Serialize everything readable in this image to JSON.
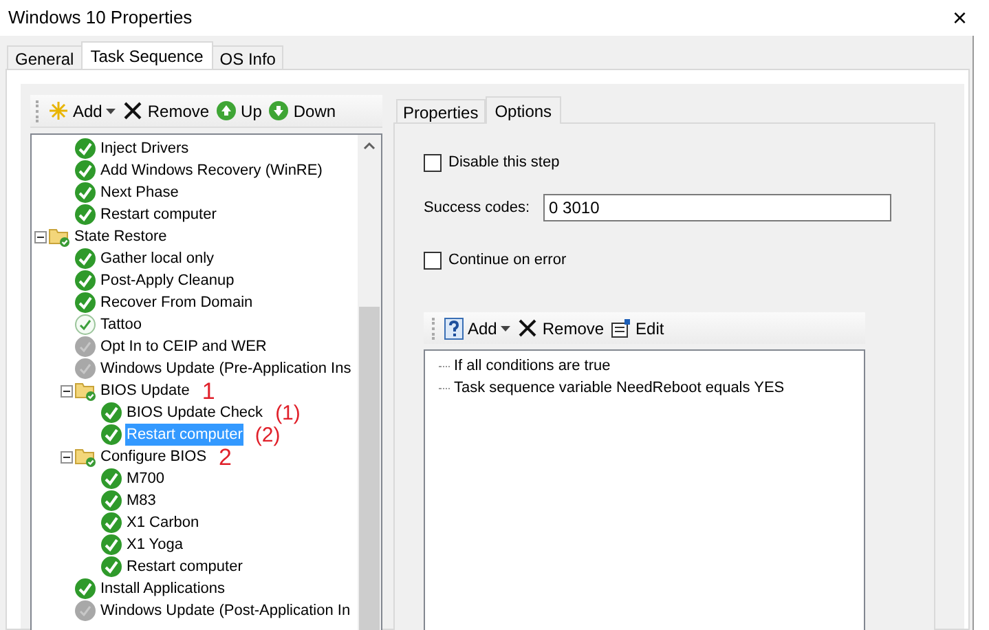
{
  "window": {
    "title": "Windows 10 Properties",
    "close": "×"
  },
  "tabs": [
    {
      "label": "General",
      "selected": false
    },
    {
      "label": "Task Sequence",
      "selected": true
    },
    {
      "label": "OS Info",
      "selected": false
    }
  ],
  "toolbar": [
    {
      "kind": "add",
      "label": "Add"
    },
    {
      "kind": "remove",
      "label": "Remove"
    },
    {
      "kind": "up",
      "label": "Up"
    },
    {
      "kind": "down",
      "label": "Down"
    }
  ],
  "tree": {
    "items": [
      {
        "kind": "offscreen-group",
        "children": [
          {
            "kind": "success",
            "label": "Inject Drivers",
            "selected": false
          },
          {
            "kind": "success",
            "label": "Add Windows Recovery (WinRE)",
            "selected": false
          },
          {
            "kind": "success",
            "label": "Next Phase",
            "selected": false
          },
          {
            "kind": "success",
            "label": "Restart computer",
            "selected": false
          }
        ]
      },
      {
        "kind": "group",
        "label": "State Restore",
        "expanded": true,
        "selected": false,
        "children": [
          {
            "kind": "success",
            "label": "Gather local only",
            "selected": false
          },
          {
            "kind": "success",
            "label": "Post-Apply Cleanup",
            "selected": false
          },
          {
            "kind": "success",
            "label": "Recover From Domain",
            "selected": false
          },
          {
            "kind": "light",
            "label": "Tattoo",
            "selected": false
          },
          {
            "kind": "disabled",
            "label": "Opt In to CEIP and WER",
            "selected": false
          },
          {
            "kind": "disabled",
            "label": "Windows Update (Pre-Application Ins",
            "selected": false
          },
          {
            "kind": "group",
            "label": "BIOS Update",
            "expanded": true,
            "selected": false,
            "annotation": "1",
            "children": [
              {
                "kind": "success",
                "label": "BIOS Update Check",
                "selected": false,
                "annotation": "(1)"
              },
              {
                "kind": "success",
                "label": "Restart computer",
                "selected": true,
                "annotation": "(2)"
              }
            ]
          },
          {
            "kind": "group",
            "label": "Configure BIOS",
            "expanded": true,
            "selected": false,
            "annotation": "2",
            "children": [
              {
                "kind": "success",
                "label": "M700",
                "selected": false
              },
              {
                "kind": "success",
                "label": "M83",
                "selected": false
              },
              {
                "kind": "success",
                "label": "X1 Carbon",
                "selected": false
              },
              {
                "kind": "success",
                "label": "X1 Yoga",
                "selected": false
              },
              {
                "kind": "success",
                "label": "Restart computer",
                "selected": false
              }
            ]
          },
          {
            "kind": "success",
            "label": "Install Applications",
            "selected": false
          },
          {
            "kind": "disabled",
            "label": "Windows Update (Post-Application In",
            "selected": false
          }
        ]
      }
    ]
  },
  "detail_tabs": [
    {
      "label": "Properties",
      "selected": false
    },
    {
      "label": "Options",
      "selected": true
    }
  ],
  "options": {
    "disable_step": {
      "label": "Disable this step",
      "checked": false
    },
    "success_codes": {
      "label": "Success codes:",
      "value": "0 3010"
    },
    "continue_on_error": {
      "label": "Continue on error",
      "checked": false
    }
  },
  "condition_toolbar": [
    {
      "kind": "add",
      "label": "Add"
    },
    {
      "kind": "remove",
      "label": "Remove"
    },
    {
      "kind": "edit",
      "label": "Edit"
    }
  ],
  "conditions": [
    {
      "label": "If all conditions are true"
    },
    {
      "label": "Task sequence variable NeedReboot equals YES"
    }
  ]
}
